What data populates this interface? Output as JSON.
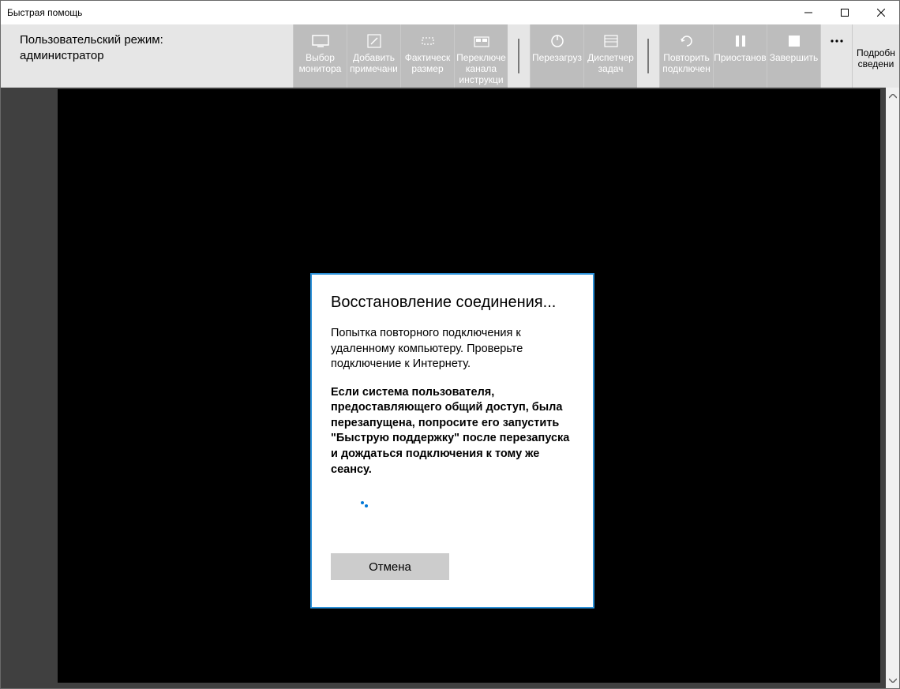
{
  "window": {
    "title": "Быстрая помощь"
  },
  "mode": {
    "line1": "Пользовательский режим:",
    "line2": "администратор"
  },
  "toolbar": {
    "select_monitor": "Выбор\nмонитора",
    "add_note": "Добавить\nпримечани",
    "actual_size": "Фактическ\nразмер",
    "switch_channel": "Переключе\nканала\nинструкци",
    "restart": "Перезагруз",
    "task_manager": "Диспетчер\nзадач",
    "reconnect": "Повторить\nподключен",
    "pause": "Приостанов",
    "end": "Завершить",
    "details": "Подробн\nсведени"
  },
  "dialog": {
    "title": "Восстановление соединения...",
    "body1": "Попытка повторного подключения к удаленному компьютеру. Проверьте подключение к Интернету.",
    "body2": "Если система пользователя, предоставляющего общий доступ, была перезапущена, попросите его запустить \"Быструю поддержку\" после перезапуска и дождаться подключения к тому же сеансу.",
    "cancel": "Отмена"
  }
}
